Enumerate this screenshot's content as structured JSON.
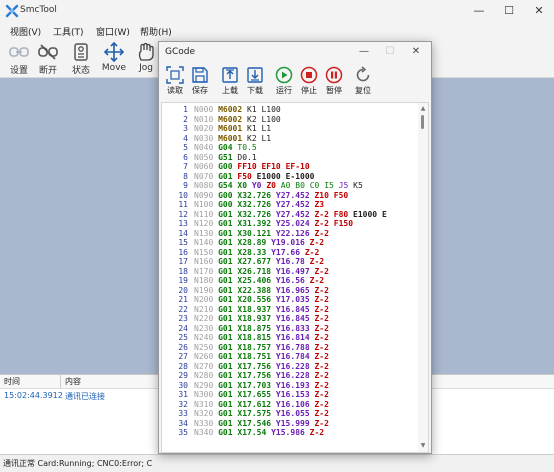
{
  "app": {
    "title": "SmcTool"
  },
  "window_controls": {
    "minimize": "—",
    "maximize": "☐",
    "close": "✕"
  },
  "menu": [
    "视图(V)",
    "工具(T)",
    "窗口(W)",
    "帮助(H)"
  ],
  "toolbar": {
    "settings": "设置",
    "disconnect": "断开",
    "status": "状态",
    "move": "Move",
    "jog": "Jog"
  },
  "log": {
    "col_time": "时间",
    "col_content": "内容",
    "rows": [
      {
        "time": "15:02:44.3912",
        "content": "通讯已连接"
      }
    ]
  },
  "status_bar": {
    "text": "通讯正常  Card:Running; CNC0:Error; C"
  },
  "gcode": {
    "title": "GCode",
    "buttons": [
      "读取",
      "保存",
      "上载",
      "下载",
      "运行",
      "停止",
      "暂停",
      "复位"
    ],
    "colors": {
      "line_num": "#2a3c9a",
      "nnum": "#a0a0a0",
      "m": "#7a5c00",
      "g": "#0a7a0a",
      "x": "#0a7a0a",
      "y": "#6a1fb4",
      "z": "#c00000",
      "f": "#c00000",
      "e": "#222222",
      "a": "#0a7a0a",
      "b": "#0a7a0a",
      "c": "#0a7a0a",
      "i": "#0a7a0a",
      "j": "#6a1fb4",
      "k": "#222222",
      "t": "#0a7a0a",
      "d": "#222222",
      "l": "#222222",
      "other": "#222222"
    },
    "lines": [
      "N000 M6002 K1 L100",
      "N010 M6002 K2 L100",
      "N020 M6001 K1 L1",
      "N030 M6001 K2 L1",
      "N040 G04 T0.5",
      "N050 G51 D0.1",
      "N060 G00 FF10 EF10 EF-10",
      "N070 G01 F50 E1000 E-1000",
      "N080 G54 X0 Y0 Z0 A0 B0 C0 I5 J5 K5",
      "N090 G00 X32.726 Y27.452 Z10 F50",
      "N100 G00 X32.726 Y27.452 Z3",
      "N110 G01 X32.726 Y27.452 Z-2 F80 E1000 E",
      "N120 G01 X31.392 Y25.024 Z-2 F150",
      "N130 G01 X30.121 Y22.126 Z-2",
      "N140 G01 X28.89 Y19.016 Z-2",
      "N150 G01 X28.33 Y17.66 Z-2",
      "N160 G01 X27.677 Y16.78 Z-2",
      "N170 G01 X26.718 Y16.497 Z-2",
      "N180 G01 X25.406 Y16.56 Z-2",
      "N190 G01 X22.388 Y16.965 Z-2",
      "N200 G01 X20.556 Y17.035 Z-2",
      "N210 G01 X18.937 Y16.845 Z-2",
      "N220 G01 X18.937 Y16.845 Z-2",
      "N230 G01 X18.875 Y16.833 Z-2",
      "N240 G01 X18.815 Y16.814 Z-2",
      "N250 G01 X18.757 Y16.788 Z-2",
      "N260 G01 X18.751 Y16.784 Z-2",
      "N270 G01 X17.756 Y16.228 Z-2",
      "N280 G01 X17.756 Y16.228 Z-2",
      "N290 G01 X17.703 Y16.193 Z-2",
      "N300 G01 X17.655 Y16.153 Z-2",
      "N310 G01 X17.612 Y16.106 Z-2",
      "N320 G01 X17.575 Y16.055 Z-2",
      "N330 G01 X17.546 Y15.999 Z-2",
      "N340 G01 X17.54 Y15.986 Z-2"
    ]
  }
}
